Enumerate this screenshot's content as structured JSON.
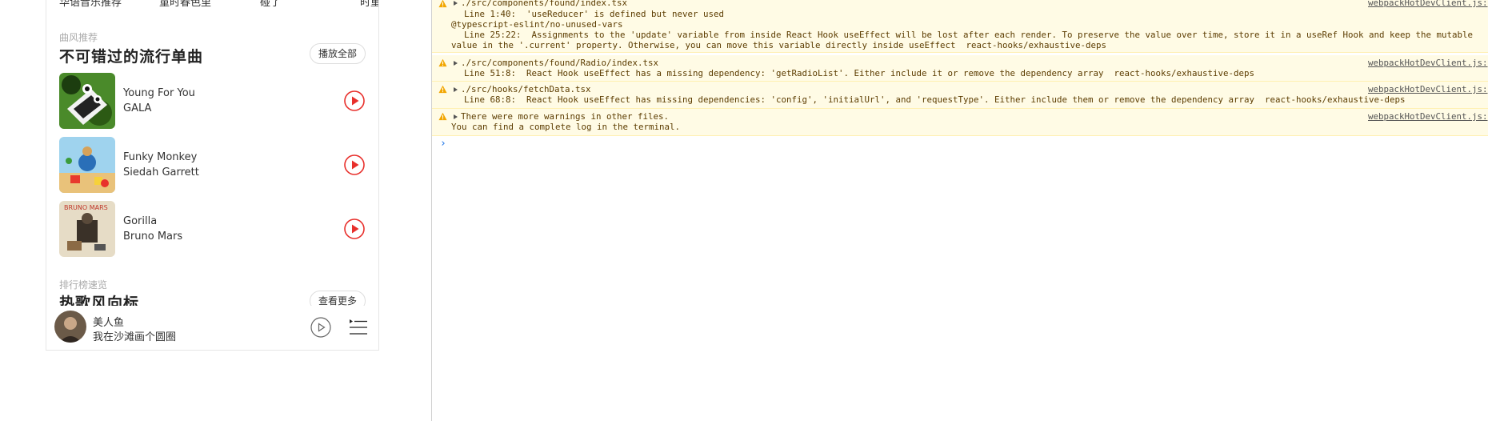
{
  "app": {
    "top_row": [
      "华语音乐推荐",
      "童时春色里",
      "碰了",
      "时重"
    ],
    "style_section": {
      "sub": "曲风推荐",
      "title": "不可错过的流行单曲",
      "action": "播放全部"
    },
    "songs": [
      {
        "name": "Young For You",
        "artist": "GALA",
        "cover_icon": "album-cover-gala"
      },
      {
        "name": "Funky Monkey",
        "artist": "Siedah Garrett",
        "cover_icon": "album-cover-rio"
      },
      {
        "name": "Gorilla",
        "artist": "Bruno Mars",
        "cover_icon": "album-cover-bruno-mars"
      }
    ],
    "chart_section": {
      "sub": "排行榜速览",
      "title": "热歌风向标",
      "action": "查看更多"
    },
    "player": {
      "title": "美人鱼",
      "subtitle": "我在沙滩画个圆圈"
    },
    "accent": "#e8302c"
  },
  "console": {
    "warnings": [
      {
        "file": "./src/components/found/index.tsx",
        "lines": [
          "  Line 1:40:  'useReducer' is defined but never used",
          "@typescript-eslint/no-unused-vars",
          "  Line 25:22:  Assignments to the 'update' variable from inside React Hook useEffect will be lost after each render. To preserve the value over time, store it in a useRef Hook and keep the mutable",
          "value in the '.current' property. Otherwise, you can move this variable directly inside useEffect  react-hooks/exhaustive-deps"
        ],
        "source": "webpackHotDevClient.js:"
      },
      {
        "file": "./src/components/found/Radio/index.tsx",
        "lines": [
          "  Line 51:8:  React Hook useEffect has a missing dependency: 'getRadioList'. Either include it or remove the dependency array  react-hooks/exhaustive-deps"
        ],
        "source": "webpackHotDevClient.js:"
      },
      {
        "file": "./src/hooks/fetchData.tsx",
        "lines": [
          "  Line 68:8:  React Hook useEffect has missing dependencies: 'config', 'initialUrl', and 'requestType'. Either include them or remove the dependency array  react-hooks/exhaustive-deps"
        ],
        "source": "webpackHotDevClient.js:"
      },
      {
        "file": "There were more warnings in other files.",
        "lines": [
          "You can find a complete log in the terminal."
        ],
        "source": "webpackHotDevClient.js:"
      }
    ],
    "prompt": "›",
    "colors": {
      "warn_bg": "#fffbe5",
      "warn_text": "#5c3c00",
      "warn_icon": "#f2a600"
    }
  }
}
